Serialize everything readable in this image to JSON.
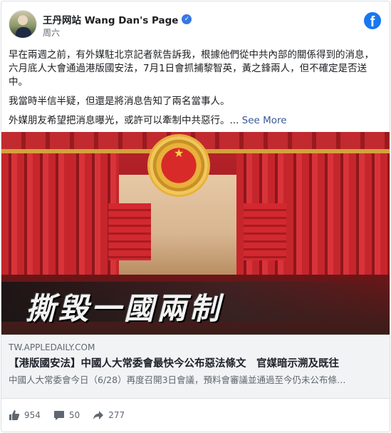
{
  "post": {
    "author": "王丹网站 Wang Dan's Page",
    "time": "周六",
    "paragraphs": [
      "早在兩週之前，有外媒駐北京記者就告訴我，根據他們從中共內部的關係得到的消息，六月底人大會通過港版國安法，7月1日會抓捕黎智英，黃之鋒兩人，但不確定是否送中。",
      "我當時半信半疑，但還是將消息告知了兩名當事人。",
      "外媒朋友希望把消息曝光，或許可以牽制中共惡行。... "
    ],
    "see_more": "See More"
  },
  "image": {
    "banner_text": "撕毀一國兩制"
  },
  "link": {
    "domain": "TW.APPLEDAILY.COM",
    "title": "【港版國安法】中國人大常委會最快今公布惡法條文　官媒暗示溯及既往",
    "description": "中國人大常委會今日（6/28）再度召開3日會議，預料會審議並通過至今仍未公布條…"
  },
  "stats": {
    "likes": "954",
    "comments": "50",
    "shares": "277"
  },
  "colors": {
    "facebook_blue": "#1877f2",
    "link_blue": "#385898",
    "secondary_text": "#606770"
  }
}
